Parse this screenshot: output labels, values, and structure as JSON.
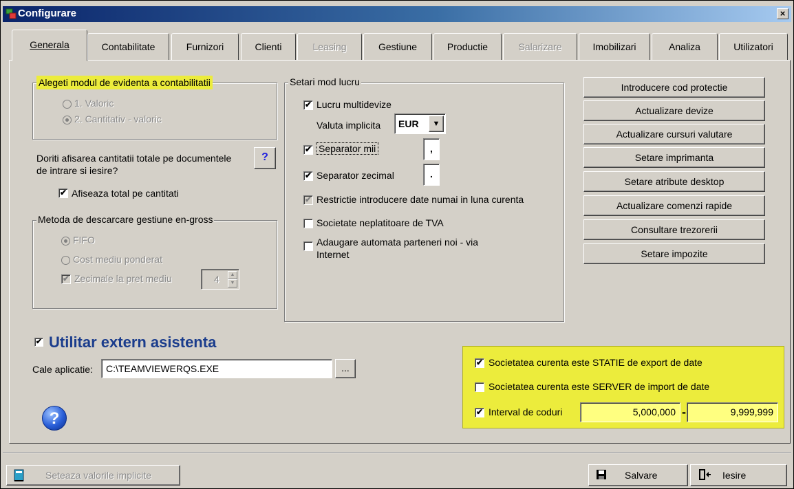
{
  "window": {
    "title": "Configurare",
    "close_glyph": "×"
  },
  "tabs": [
    {
      "label": "Generala",
      "state": "active"
    },
    {
      "label": "Contabilitate",
      "state": "normal"
    },
    {
      "label": "Furnizori",
      "state": "normal"
    },
    {
      "label": "Clienti",
      "state": "normal"
    },
    {
      "label": "Leasing",
      "state": "disabled"
    },
    {
      "label": "Gestiune",
      "state": "normal"
    },
    {
      "label": "Productie",
      "state": "normal"
    },
    {
      "label": "Salarizare",
      "state": "disabled"
    },
    {
      "label": "Imobilizari",
      "state": "normal"
    },
    {
      "label": "Analiza",
      "state": "normal"
    },
    {
      "label": "Utilizatori",
      "state": "normal"
    }
  ],
  "accounting_mode": {
    "legend": "Alegeti modul de evidenta a contabilitatii",
    "option1": "1. Valoric",
    "option2": "2. Cantitativ - valoric",
    "selected": "2. Cantitativ - valoric"
  },
  "totals_question": {
    "text_line1": "Doriti afisarea cantitatii totale pe documentele",
    "text_line2": "de intrare si iesire?",
    "help_label": "?",
    "checkbox_label": "Afiseaza total pe cantitati",
    "checked": true
  },
  "stock_method": {
    "legend": "Metoda de descarcare gestiune en-gross",
    "option_fifo": "FIFO",
    "option_cost": "Cost mediu ponderat",
    "decimals_label": "Zecimale la pret mediu",
    "decimals_value": "4",
    "selected": "FIFO"
  },
  "work_settings": {
    "legend": "Setari mod lucru",
    "multi_currency": "Lucru multidevize",
    "default_currency_label": "Valuta implicita",
    "default_currency_value": "EUR",
    "thousands_sep_label": "Separator mii",
    "thousands_sep_value": ",",
    "decimal_sep_label": "Separator zecimal",
    "decimal_sep_value": ".",
    "restrict_label": "Restrictie introducere date numai in luna curenta",
    "vat_label": "Societate neplatitoare de TVA",
    "auto_partners_line1": "Adaugare automata parteneri noi - via",
    "auto_partners_line2": "Internet",
    "dropdown_glyph": "▼"
  },
  "right_buttons": [
    "Introducere cod protectie",
    "Actualizare devize",
    "Actualizare cursuri valutare",
    "Setare imprimanta",
    "Setare atribute desktop",
    "Actualizare comenzi rapide",
    "Consultare trezorerii",
    "Setare impozite"
  ],
  "assistance": {
    "title": "Utilitar extern asistenta",
    "path_label": "Cale aplicatie:",
    "path_value": "C:\\TEAMVIEWERQS.EXE",
    "browse_label": "..."
  },
  "export_panel": {
    "station_label": "Societatea curenta este STATIE de export de date",
    "server_label": "Societatea curenta este SERVER de import de date",
    "interval_label": "Interval de coduri",
    "interval_from": "5,000,000",
    "interval_sep": "-",
    "interval_to": "9,999,999"
  },
  "help_glyph": "?",
  "checkmark": "✔",
  "footer": {
    "defaults_label": "Seteaza valorile implicite",
    "save_label": "Salvare",
    "exit_label": "Iesire"
  }
}
